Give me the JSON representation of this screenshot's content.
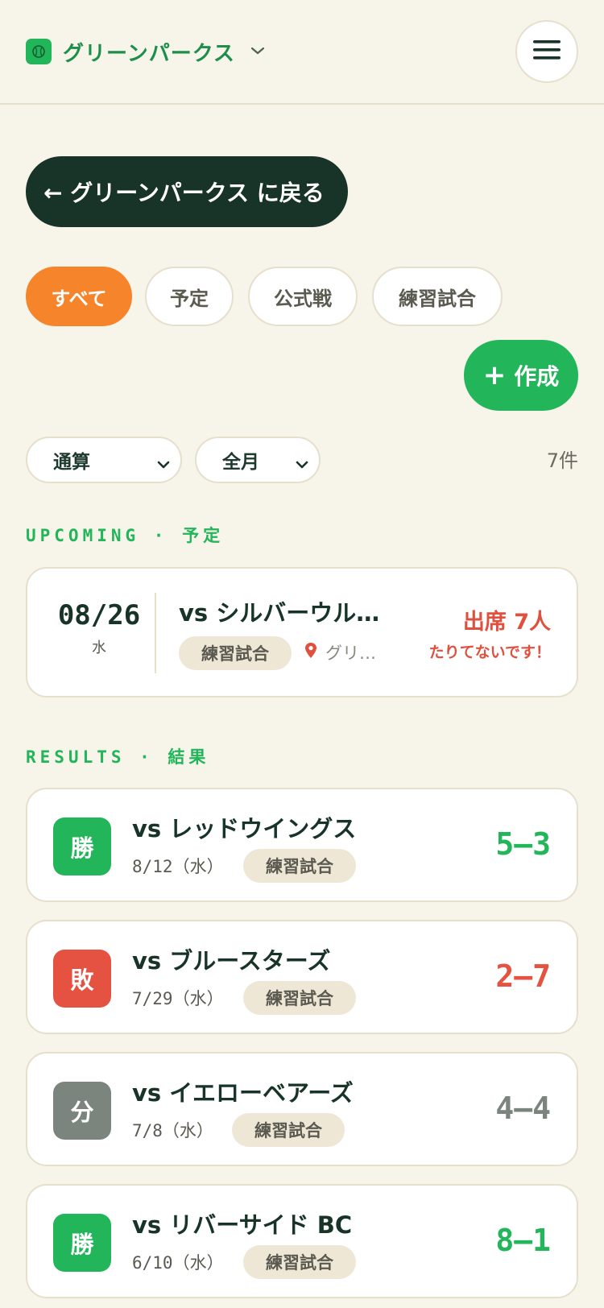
{
  "header": {
    "team_name": "グリーンパークス",
    "logo_icon": "baseball-icon",
    "dropdown_icon": "chevron-down-icon",
    "menu_icon": "hamburger-menu-icon"
  },
  "back_button": {
    "label": "← グリーンパークス に戻る"
  },
  "filters": {
    "chips": [
      {
        "label": "すべて",
        "active": true
      },
      {
        "label": "予定",
        "active": false
      },
      {
        "label": "公式戦",
        "active": false
      },
      {
        "label": "練習試合",
        "active": false
      }
    ]
  },
  "create_button": {
    "plus": "+",
    "label": "作成"
  },
  "selects": {
    "period": "通算",
    "month": "全月",
    "count": "7件"
  },
  "upcoming": {
    "section_label": "UPCOMING · 予定",
    "game": {
      "date": "08/26",
      "weekday": "水",
      "opponent": "vs シルバーウルフズ",
      "type": "練習試合",
      "location": "グリーンパーク",
      "attendance": "出席 7人",
      "warning": "たりてないです！"
    }
  },
  "results": {
    "section_label": "RESULTS · 結果",
    "games": [
      {
        "badge": "勝",
        "opponent": "vs レッドウイングス",
        "date": "8/12（水）",
        "type": "練習試合",
        "score": "5–3",
        "color": "#22b55a"
      },
      {
        "badge": "敗",
        "opponent": "vs ブルースターズ",
        "date": "7/29（水）",
        "type": "練習試合",
        "score": "2–7",
        "color": "#e65241"
      },
      {
        "badge": "分",
        "opponent": "vs イエローベアーズ",
        "date": "7/8（水）",
        "type": "練習試合",
        "score": "4–4",
        "color": "#7c857d"
      },
      {
        "badge": "勝",
        "opponent": "vs リバーサイド BC",
        "date": "6/10（水）",
        "type": "練習試合",
        "score": "8–1",
        "color": "#22b55a"
      }
    ]
  },
  "colors": {
    "background": "#f7f4ea",
    "accent_green": "#22b55a",
    "accent_orange": "#f5842a",
    "dark": "#183428",
    "loss_red": "#e65241",
    "draw_gray": "#7c857d"
  }
}
